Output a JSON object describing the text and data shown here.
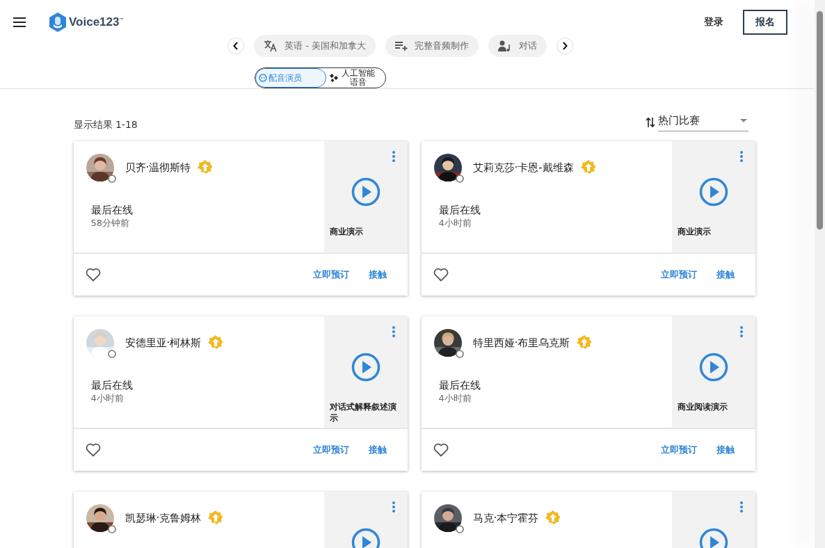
{
  "header": {
    "brand": "Voice123$^{™}$",
    "login": "登录",
    "signup": "报名"
  },
  "filters": [
    {
      "kind": "language",
      "label": "英语 - 美国和加拿大"
    },
    {
      "kind": "production",
      "label": "完整音频制作"
    },
    {
      "kind": "dialogue",
      "label": "对话"
    }
  ],
  "talent_toggle": [
    {
      "kind": "actor",
      "label": "配音演员",
      "selected": true
    },
    {
      "kind": "ai",
      "label": "人工智能语音",
      "selected": false
    }
  ],
  "results": {
    "summary": "显示结果 1-18",
    "sort": "热门比赛"
  },
  "cards": [
    {
      "name": "贝齐·温彻斯特",
      "last_online_label": "最后在线",
      "last_online": "58分钟前",
      "demo": "商业演示",
      "book": "立即预订",
      "contact": "接触"
    },
    {
      "name": "艾莉克莎·卡恩-戴维森",
      "last_online_label": "最后在线",
      "last_online": "4小时前",
      "demo": "商业演示",
      "book": "立即预订",
      "contact": "接触"
    },
    {
      "name": "安德里亚·柯林斯",
      "last_online_label": "最后在线",
      "last_online": "4小时前",
      "demo": "对话式解释叙述演示",
      "book": "立即预订",
      "contact": "接触"
    },
    {
      "name": "特里西娅·布里乌克斯",
      "last_online_label": "最后在线",
      "last_online": "4小时前",
      "demo": "商业阅读演示",
      "book": "立即预订",
      "contact": "接触"
    },
    {
      "name": "凯瑟琳·克鲁姆林"
    },
    {
      "name": "马克·本宁霍芬"
    }
  ]
}
